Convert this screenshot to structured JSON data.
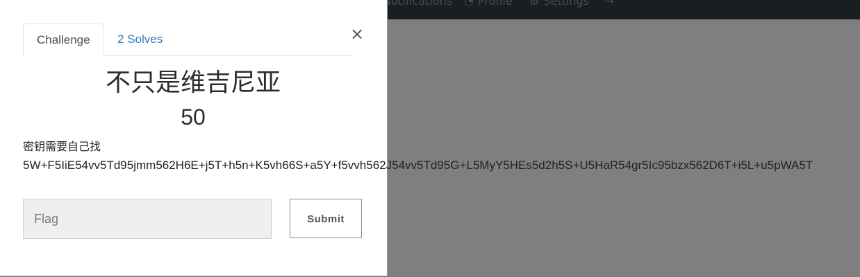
{
  "navbar": {
    "items": [
      {
        "label": "Notifications",
        "icon": "bell-icon"
      },
      {
        "label": "Profile",
        "icon": "user-icon"
      },
      {
        "label": "Settings",
        "icon": "gear-icon"
      },
      {
        "label": "",
        "icon": "logout-icon"
      }
    ]
  },
  "modal": {
    "tabs": [
      {
        "label": "Challenge",
        "active": true
      },
      {
        "label": "2 Solves",
        "active": false
      }
    ],
    "close_glyph": "×",
    "challenge_name": "不只是维吉尼亚",
    "challenge_value": "50",
    "description_line1": "密钥需要自己找",
    "description_line2": "5W+F5IiE54vv5Td95jmm562H6E+j5T+h5n+K5vh66S+a5Y+f5vvh562J54vv5Td95G+L5MyY5HEs5d2h5S+U5HaR54gr5Ic95bzx562D6T+i5L+u5pWA5T",
    "flag_placeholder": "Flag",
    "submit_label": "Submit"
  },
  "colors": {
    "link": "#337ab7",
    "backdrop": "#7f7f7f",
    "navbar": "#1b1e20"
  }
}
